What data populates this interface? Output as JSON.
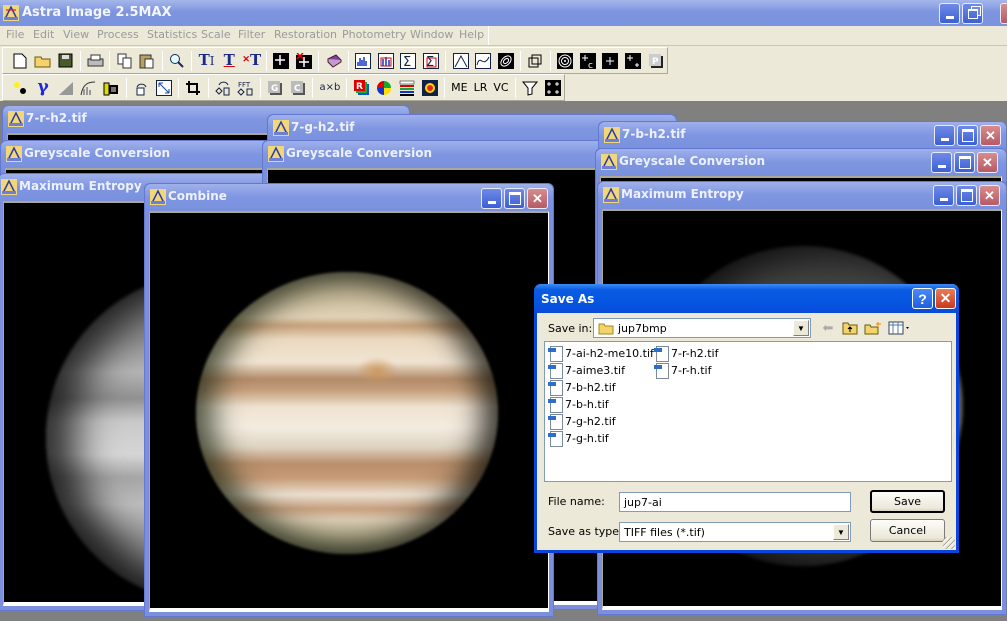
{
  "app": {
    "title": "Astra Image 2.5MAX"
  },
  "menu": [
    "File",
    "Edit",
    "View",
    "Process",
    "Statistics",
    "Scale",
    "Filter",
    "Restoration",
    "Photometry",
    "Window",
    "Help"
  ],
  "toolbar": {
    "row1": [
      "new-file",
      "open-folder",
      "save-disk",
      "print",
      "copy",
      "paste",
      "zoom-magnifier",
      "text-insert",
      "text-underline",
      "text-delete",
      "crosshair-1",
      "crosshair-delete",
      "help-book",
      "histogram",
      "histogram-select",
      "sigma-sum",
      "sigma-select",
      "triangle-curve",
      "wave-curve",
      "spiral",
      "cube-3d",
      "target-rings",
      "star-c",
      "star",
      "star-plus",
      "p-button"
    ],
    "row2": [
      "brightness",
      "gamma",
      "levels",
      "curves",
      "film-strip",
      "rotate",
      "resize",
      "crop",
      "rotate-transform",
      "fft",
      "grey-button",
      "c-button",
      "a-times-b",
      "rgb-r",
      "color-wheel",
      "color-bars",
      "false-color",
      "ME",
      "LR",
      "VC",
      "filter-funnel",
      "grid-stars"
    ],
    "text_buttons": {
      "me": "ME",
      "lr": "LR",
      "vc": "VC",
      "axb": "a×b",
      "fft": "FFT"
    }
  },
  "windows": [
    {
      "title": "7-r-h2.tif"
    },
    {
      "title": "Greyscale Conversion"
    },
    {
      "title": "Maximum Entropy"
    },
    {
      "title": "7-g-h2.tif"
    },
    {
      "title": "Greyscale Conversion"
    },
    {
      "title": "7-b-h2.tif"
    },
    {
      "title": "Greyscale Conversion"
    },
    {
      "title": "Maximum Entropy"
    },
    {
      "title": "Combine"
    }
  ],
  "dialog": {
    "title": "Save As",
    "save_in_label": "Save in:",
    "save_in_value": "jup7bmp",
    "files": [
      "7-ai-h2-me10.tif",
      "7-aime3.tif",
      "7-b-h2.tif",
      "7-b-h.tif",
      "7-g-h2.tif",
      "7-g-h.tif",
      "7-r-h2.tif",
      "7-r-h.tif"
    ],
    "file_name_label": "File name:",
    "file_name_value": "jup7-ai",
    "type_label": "Save as type:",
    "type_value": "TIFF files (*.tif)",
    "save_button": "Save",
    "cancel_button": "Cancel",
    "help_glyph": "?",
    "close_glyph": "✕"
  },
  "colors": {
    "titlebar_inactive": "#7b93de",
    "dialog_titlebar": "#0454e1",
    "face": "#ece9d8",
    "desktop": "#808080"
  }
}
